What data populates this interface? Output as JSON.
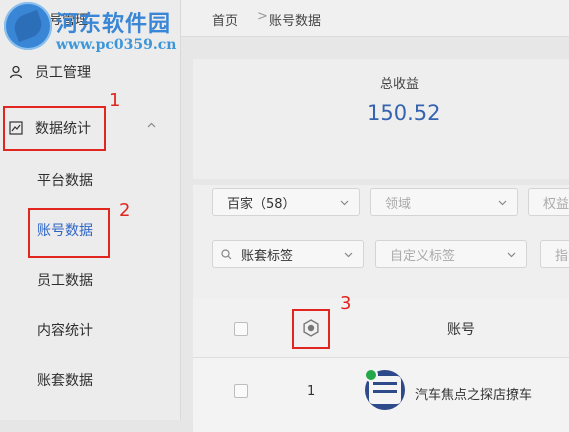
{
  "watermark": {
    "site_name": "河东软件园",
    "url": "www.pc0359.cn",
    "under_text": "账号管理"
  },
  "sidebar": {
    "items": [
      {
        "label": "员工管理",
        "icon": "user-icon"
      },
      {
        "label": "数据统计",
        "icon": "chart-icon"
      },
      {
        "label": "平台数据"
      },
      {
        "label": "账号数据"
      },
      {
        "label": "员工数据"
      },
      {
        "label": "内容统计"
      },
      {
        "label": "账套数据"
      }
    ]
  },
  "breadcrumb": {
    "home": "首页",
    "separator": ">",
    "current": "账号数据"
  },
  "summary": {
    "label": "总收益",
    "value": "150.52"
  },
  "filters": {
    "row1": [
      "百家（58）",
      "领域",
      "权益"
    ],
    "row2": [
      "账套标签",
      "自定义标签",
      "指"
    ]
  },
  "table": {
    "header_account": "账号",
    "rows": [
      {
        "index": "1",
        "account": "汽车焦点之探店撩车"
      }
    ]
  },
  "annotations": [
    "1",
    "2",
    "3"
  ],
  "colors": {
    "accent": "#2e64c6",
    "annotation": "#e0261e",
    "watermark": "#3a86d6"
  }
}
